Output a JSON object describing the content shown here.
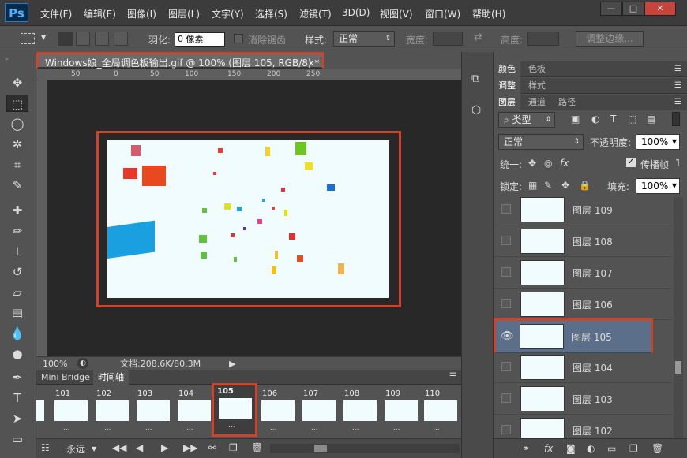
{
  "app": {
    "logo": "Ps"
  },
  "menus": [
    "文件(F)",
    "编辑(E)",
    "图像(I)",
    "图层(L)",
    "文字(Y)",
    "选择(S)",
    "滤镜(T)",
    "3D(D)",
    "视图(V)",
    "窗口(W)",
    "帮助(H)"
  ],
  "window_buttons": {
    "minimize": "—",
    "maximize": "□",
    "close": "✕"
  },
  "options": {
    "feather_label": "羽化:",
    "feather_value": "0 像素",
    "antialias_label": "消除锯齿",
    "style_label": "样式:",
    "style_value": "正常",
    "width_label": "宽度:",
    "height_label": "高度:",
    "refine_edge": "调整边缘..."
  },
  "document": {
    "tab_title": "Windows娘_全局调色板输出.gif @ 100% (图层 105, RGB/8) *",
    "close_glyph": "×",
    "ruler_marks": [
      "50",
      "0",
      "50",
      "100",
      "150",
      "200",
      "250"
    ],
    "zoom": "100%",
    "doc_info": "文档:208.6K/80.3M"
  },
  "timeline": {
    "tabs": [
      "Mini Bridge",
      "时间轴"
    ],
    "frames": [
      {
        "num": "101",
        "delay": "..."
      },
      {
        "num": "102",
        "delay": "..."
      },
      {
        "num": "103",
        "delay": "..."
      },
      {
        "num": "104",
        "delay": "..."
      },
      {
        "num": "105",
        "delay": "..."
      },
      {
        "num": "106",
        "delay": "..."
      },
      {
        "num": "107",
        "delay": "..."
      },
      {
        "num": "108",
        "delay": "..."
      },
      {
        "num": "109",
        "delay": "..."
      },
      {
        "num": "110",
        "delay": "..."
      }
    ],
    "selected_frame": "105",
    "loop_value": "永远"
  },
  "panels": {
    "row1_tabs": [
      "颜色",
      "色板"
    ],
    "row2_tabs": [
      "调整",
      "样式"
    ],
    "row3_tabs": [
      "图层",
      "通道",
      "路径"
    ],
    "filter_kind": "类型",
    "blend_mode": "正常",
    "opacity_label": "不透明度:",
    "opacity_value": "100%",
    "unify_label": "统一:",
    "propagate_label": "传播帧",
    "propagate_num": "1",
    "lock_label": "锁定:",
    "fill_label": "填充:",
    "fill_value": "100%",
    "layers": [
      {
        "name": "图层 109",
        "visible": false
      },
      {
        "name": "图层 108",
        "visible": false
      },
      {
        "name": "图层 107",
        "visible": false
      },
      {
        "name": "图层 106",
        "visible": false
      },
      {
        "name": "图层 105",
        "visible": true
      },
      {
        "name": "图层 104",
        "visible": false
      },
      {
        "name": "图层 103",
        "visible": false
      },
      {
        "name": "图层 102",
        "visible": false
      }
    ]
  },
  "colors": {
    "highlight": "#c9452e",
    "selected_layer": "#5b6e8a",
    "canvas_bg": "#f0fcfd"
  }
}
